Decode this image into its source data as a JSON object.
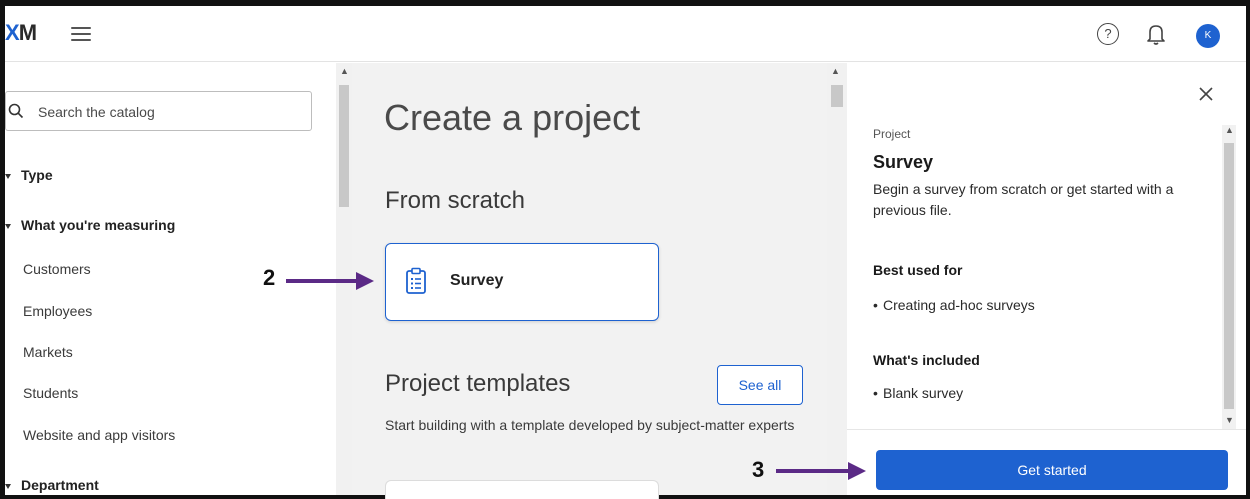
{
  "header": {
    "logo_x": "X",
    "logo_m": "M",
    "help_symbol": "?",
    "avatar_initial": "K"
  },
  "sidebar": {
    "search": {
      "placeholder": "Search the catalog"
    },
    "facets": [
      {
        "label": "Type"
      },
      {
        "label": "What you're measuring"
      },
      {
        "label": "Department"
      }
    ],
    "measuring_items": [
      {
        "label": "Customers"
      },
      {
        "label": "Employees"
      },
      {
        "label": "Markets"
      },
      {
        "label": "Students"
      },
      {
        "label": "Website and app visitors"
      }
    ]
  },
  "main": {
    "title": "Create a project",
    "from_scratch": {
      "title": "From scratch",
      "card_label": "Survey"
    },
    "templates": {
      "title": "Project templates",
      "see_all": "See all",
      "description": "Start building with a template developed by subject-matter experts"
    }
  },
  "panel": {
    "kicker": "Project",
    "title": "Survey",
    "description": "Begin a survey from scratch or get started with a previous file.",
    "best_used_for": {
      "heading": "Best used for",
      "items": [
        "Creating ad-hoc surveys"
      ]
    },
    "whats_included": {
      "heading": "What's included",
      "items": [
        "Blank survey"
      ]
    },
    "cta": "Get started"
  },
  "annotations": [
    {
      "number": "2"
    },
    {
      "number": "3"
    }
  ],
  "colors": {
    "accent": "#1e62d0",
    "annotation_arrow": "#5b2a86"
  }
}
